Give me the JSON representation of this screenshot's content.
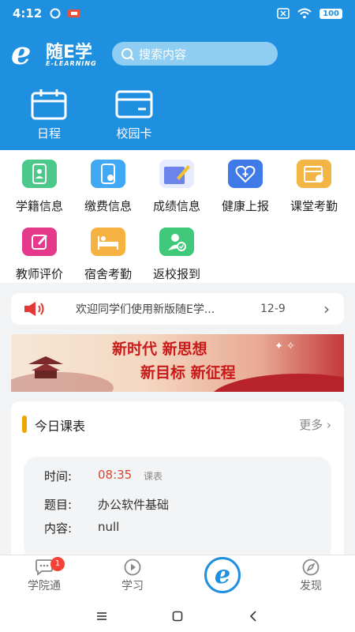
{
  "status": {
    "time": "4:12",
    "battery": "100"
  },
  "header": {
    "logo_cn": "随E学",
    "logo_en": "E-LEARNING",
    "search_placeholder": "搜索内容",
    "quick": [
      {
        "label": "日程",
        "icon": "calendar-icon"
      },
      {
        "label": "校园卡",
        "icon": "card-icon"
      }
    ]
  },
  "grid": {
    "items": [
      {
        "label": "学籍信息",
        "icon": "student-record-icon",
        "color": "#4cc98a"
      },
      {
        "label": "缴费信息",
        "icon": "payment-icon",
        "color": "#3fa9f5"
      },
      {
        "label": "成绩信息",
        "icon": "grades-icon",
        "color": "#5b7be9"
      },
      {
        "label": "健康上报",
        "icon": "health-icon",
        "color": "#3f7ae8"
      },
      {
        "label": "课堂考勤",
        "icon": "class-attendance-icon",
        "color": "#f3b545"
      },
      {
        "label": "教师评价",
        "icon": "teacher-review-icon",
        "color": "#e53a8b"
      },
      {
        "label": "宿舍考勤",
        "icon": "dorm-attendance-icon",
        "color": "#f5b240"
      },
      {
        "label": "返校报到",
        "icon": "return-checkin-icon",
        "color": "#3fc77a"
      }
    ]
  },
  "notice": {
    "text": "欢迎同学们使用新版随E学...",
    "date": "12-9",
    "icon": "speaker-icon"
  },
  "banner": {
    "line1": "新时代 新思想",
    "line2": "新目标 新征程"
  },
  "schedule": {
    "title": "今日课表",
    "more": "更多",
    "lesson": {
      "time_label": "时间:",
      "time_value": "08:35",
      "tag": "课表",
      "subject_label": "题目:",
      "subject_value": "办公软件基础",
      "content_label": "内容:",
      "content_value": "null"
    }
  },
  "tabbar": {
    "tabs": [
      {
        "label": "学院通",
        "badge": "1"
      },
      {
        "label": "学习"
      },
      {
        "label": "发现"
      }
    ]
  }
}
